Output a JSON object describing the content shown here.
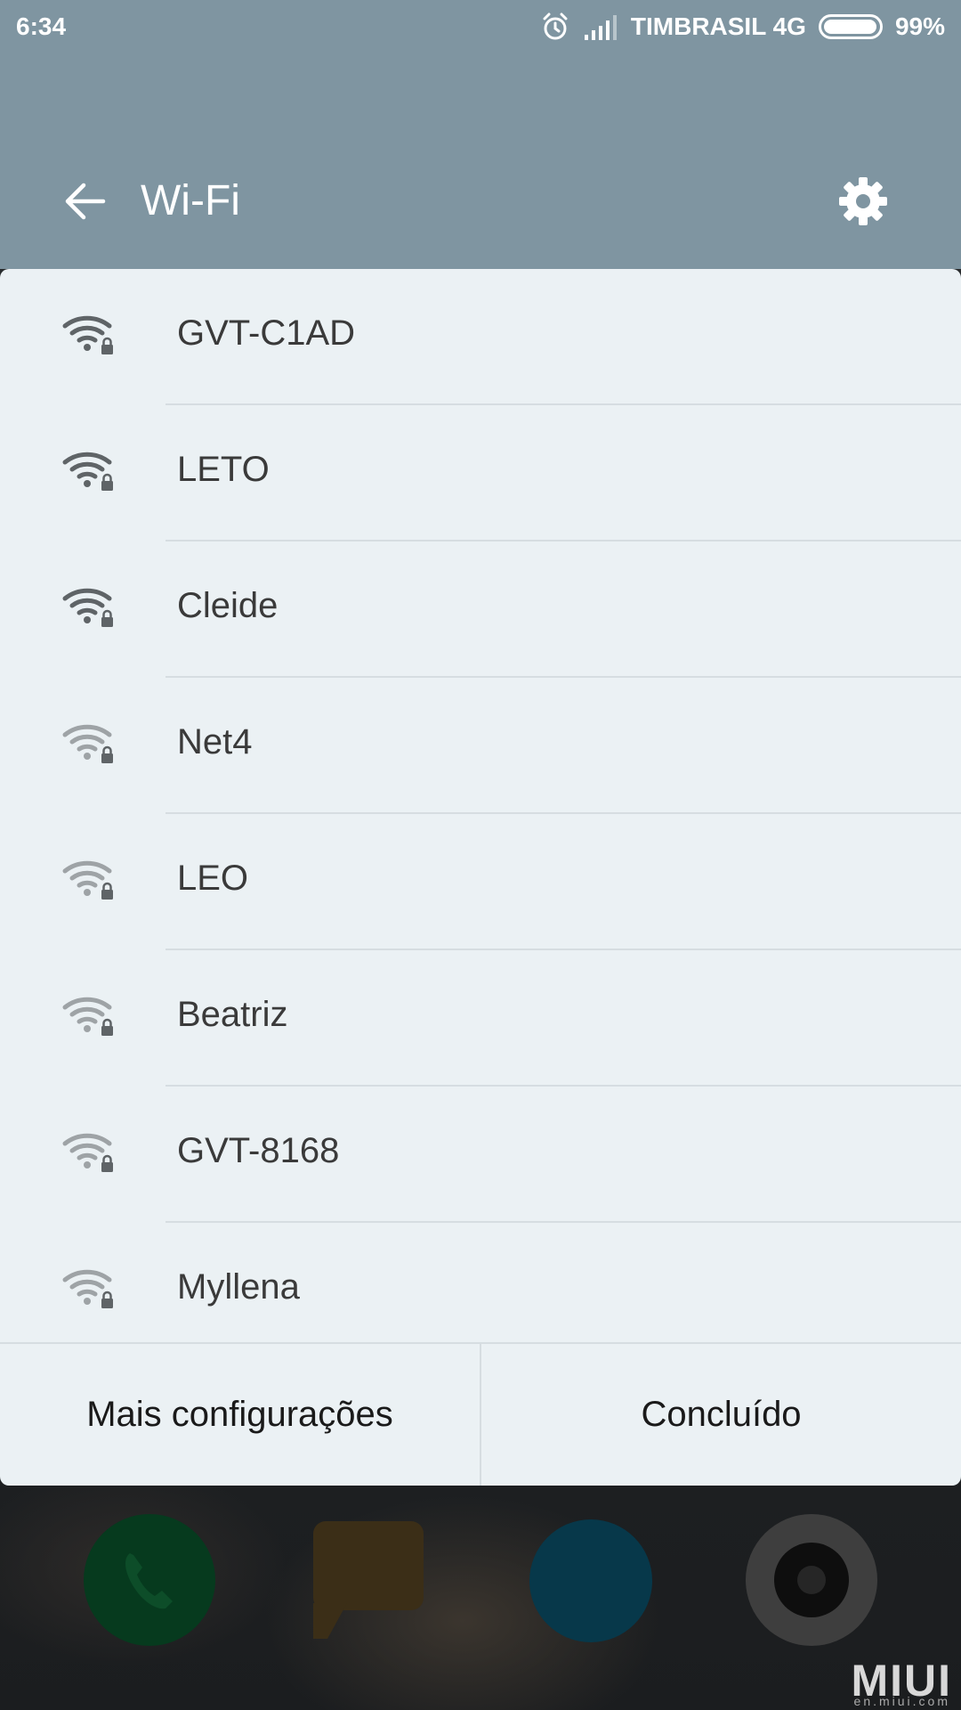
{
  "status_bar": {
    "time": "6:34",
    "carrier": "TIMBRASIL 4G",
    "battery_text": "99%",
    "battery_level": 0.99,
    "icons": [
      "alarm-icon",
      "signal-icon",
      "battery-icon"
    ]
  },
  "toolbar": {
    "title": "Wi-Fi",
    "back_icon": "arrow-left-icon",
    "settings_icon": "gear-icon"
  },
  "wifi_networks": [
    {
      "ssid": "GVT-C1AD",
      "signal": "strong",
      "secured": true
    },
    {
      "ssid": "LETO",
      "signal": "strong",
      "secured": true
    },
    {
      "ssid": "Cleide",
      "signal": "strong",
      "secured": true
    },
    {
      "ssid": "Net4",
      "signal": "weak",
      "secured": true
    },
    {
      "ssid": "LEO",
      "signal": "weak",
      "secured": true
    },
    {
      "ssid": "Beatriz",
      "signal": "weak",
      "secured": true
    },
    {
      "ssid": "GVT-8168",
      "signal": "weak",
      "secured": true
    },
    {
      "ssid": "Myllena",
      "signal": "weak",
      "secured": true
    }
  ],
  "footer": {
    "more_settings": "Mais configurações",
    "done": "Concluído"
  },
  "watermark": {
    "brand": "MIUI",
    "site": "en.miui.com"
  },
  "colors": {
    "header_bg": "#7f95a1",
    "sheet_bg": "#ebf1f4",
    "icon_strong": "#5f6467",
    "icon_weak": "#9ea3a6"
  }
}
